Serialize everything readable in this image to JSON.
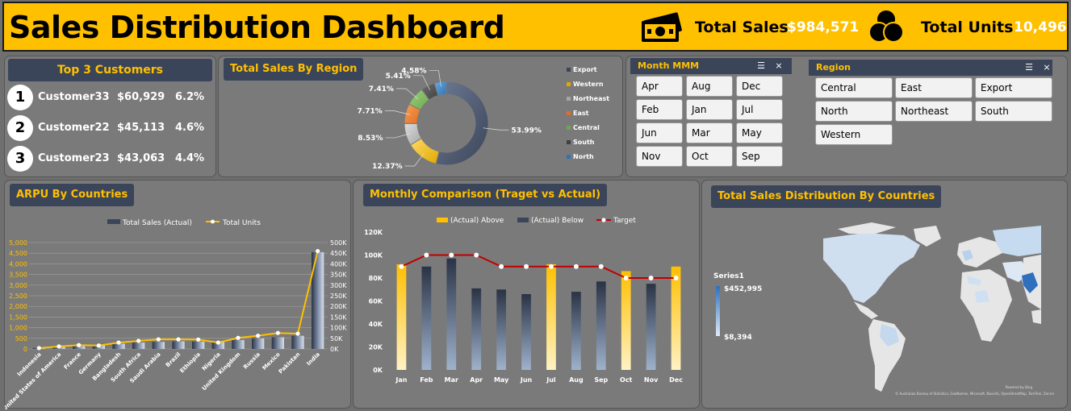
{
  "header": {
    "title": "Sales Distribution Dashboard",
    "total_sales_label": "Total Sales",
    "total_sales_value": "$984,571",
    "total_units_label": "Total Units",
    "total_units_value": "10,496",
    "money_icon": "money-icon",
    "units_icon": "venn-circles-icon"
  },
  "top_customers": {
    "title": "Top  3 Customers",
    "rows": [
      {
        "rank": "1",
        "name": "Customer33",
        "value": "$60,929",
        "pct": "6.2%"
      },
      {
        "rank": "2",
        "name": "Customer22",
        "value": "$45,113",
        "pct": "4.6%"
      },
      {
        "rank": "3",
        "name": "Customer23",
        "value": "$43,063",
        "pct": "4.4%"
      }
    ]
  },
  "region_donut": {
    "title": "Total Sales By Region"
  },
  "month_slicer": {
    "title": "Month MMM",
    "items": [
      "Apr",
      "Aug",
      "Dec",
      "Feb",
      "Jan",
      "Jul",
      "Jun",
      "Mar",
      "May",
      "Nov",
      "Oct",
      "Sep"
    ]
  },
  "region_slicer": {
    "title": "Region",
    "items": [
      "Central",
      "East",
      "Export",
      "North",
      "Northeast",
      "South",
      "Western"
    ]
  },
  "arpu": {
    "title": "ARPU By Countries"
  },
  "monthly": {
    "title": "Monthly Comparison (Traget vs Actual)"
  },
  "map": {
    "title": "Total Sales Distribution By Countries",
    "legend_title": "Series1",
    "legend_max": "$452,995",
    "legend_min": "$8,394",
    "attribution1": "Powered by Bing",
    "attribution2": "© Australian Bureau of Statistics, GeoNames, Microsoft, Navinfo, OpenStreetMap, TomTom, Zenrin"
  },
  "colors": {
    "accent": "#ffc000",
    "navy": "#3b4559",
    "panel": "#7a7a7a",
    "background": "#6f6f6f",
    "target_line": "#c00000"
  },
  "chart_data": [
    {
      "type": "pie",
      "title": "Total Sales By Region",
      "donut": true,
      "categories": [
        "Export",
        "Western",
        "Northeast",
        "East",
        "Central",
        "South",
        "North"
      ],
      "values": [
        53.99,
        12.37,
        8.53,
        7.71,
        7.41,
        5.41,
        4.58
      ],
      "labels": [
        "53.99%",
        "12.37%",
        "8.53%",
        "7.71%",
        "7.41%",
        "5.41%",
        "4.58%"
      ],
      "legend": "right"
    },
    {
      "type": "bar",
      "title": "ARPU By Countries",
      "categories": [
        "Indonesia",
        "United States of America",
        "France",
        "Germany",
        "Bangladesh",
        "South Africa",
        "Saudi Arabia",
        "Brazil",
        "Ethiopia",
        "Nigeria",
        "United Kingdom",
        "Russia",
        "Mexico",
        "Pakistan",
        "India"
      ],
      "series": [
        {
          "name": "Total Sales (Actual)",
          "kind": "bar",
          "axis": "left",
          "values": [
            50,
            100,
            130,
            170,
            250,
            300,
            330,
            360,
            350,
            320,
            420,
            500,
            550,
            620,
            4550
          ]
        },
        {
          "name": "Total Units",
          "kind": "line",
          "axis": "right",
          "values": [
            4000,
            12000,
            18000,
            16000,
            30000,
            38000,
            45000,
            45000,
            44000,
            30000,
            52000,
            62000,
            75000,
            72000,
            460000
          ]
        }
      ],
      "ylim_left": [
        0,
        5000
      ],
      "yticks_left": [
        "0",
        "500",
        "1,000",
        "1,500",
        "2,000",
        "2,500",
        "3,000",
        "3,500",
        "4,000",
        "4,500",
        "5,000"
      ],
      "ylim_right": [
        0,
        500000
      ],
      "yticks_right": [
        "0K",
        "50K",
        "100K",
        "150K",
        "200K",
        "250K",
        "300K",
        "350K",
        "400K",
        "450K",
        "500K"
      ],
      "legend": "top",
      "grid": true
    },
    {
      "type": "bar",
      "title": "Monthly Comparison (Traget vs Actual)",
      "categories": [
        "Jan",
        "Feb",
        "Mar",
        "Apr",
        "May",
        "Jun",
        "Jul",
        "Aug",
        "Sep",
        "Oct",
        "Nov",
        "Dec"
      ],
      "series": [
        {
          "name": "(Actual) Above",
          "kind": "bar",
          "values": [
            92000,
            null,
            null,
            null,
            null,
            null,
            92000,
            null,
            null,
            86000,
            null,
            90000
          ]
        },
        {
          "name": "(Actual) Below",
          "kind": "bar",
          "values": [
            null,
            90000,
            97000,
            71000,
            70000,
            66000,
            null,
            68000,
            77000,
            null,
            75000,
            null
          ]
        },
        {
          "name": "Target",
          "kind": "line",
          "values": [
            90000,
            100000,
            100000,
            100000,
            90000,
            90000,
            90000,
            90000,
            90000,
            80000,
            80000,
            80000
          ]
        }
      ],
      "ylim": [
        0,
        120000
      ],
      "yticks": [
        "0K",
        "20K",
        "40K",
        "60K",
        "80K",
        "100K",
        "120K"
      ],
      "legend": "top"
    },
    {
      "type": "heatmap",
      "title": "Total Sales Distribution By Countries",
      "series_name": "Series1",
      "range": [
        "$8,394",
        "$452,995"
      ]
    }
  ]
}
